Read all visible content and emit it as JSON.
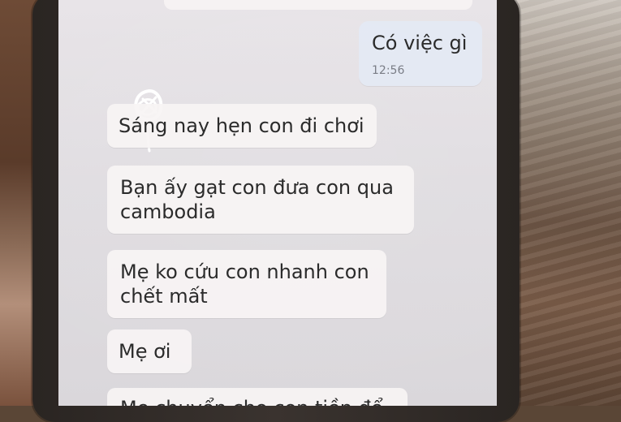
{
  "messages": {
    "outgoing": {
      "text": "Có việc gì",
      "time": "12:56"
    },
    "incoming": [
      "Sáng nay hẹn con đi chơi",
      "Bạn ấy gạt con  đưa con qua cambodia",
      "Mẹ ko cứu con nhanh con chết mất",
      "Mẹ ơi"
    ],
    "partial_bottom": "Mẹ chuyển cho con tiền để"
  },
  "icons": {
    "avatar": "scribbled-avatar-icon"
  }
}
